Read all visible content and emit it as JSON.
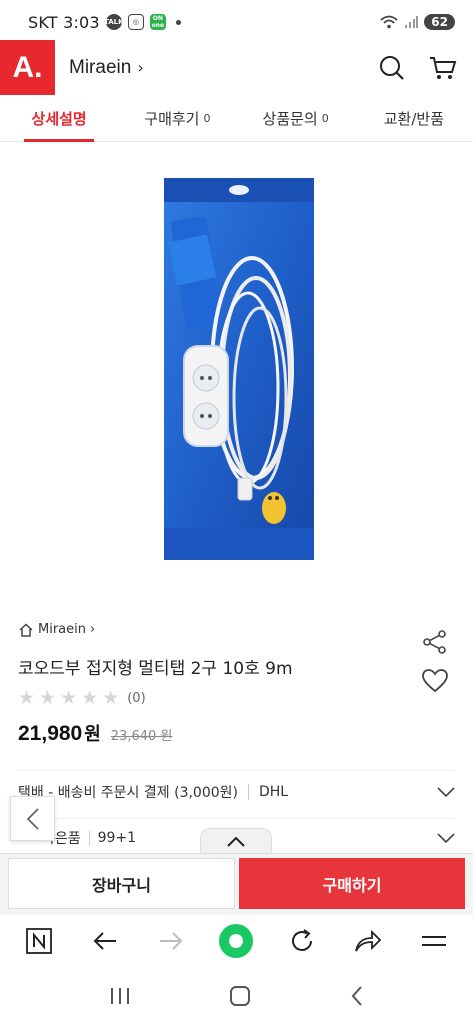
{
  "status_bar": {
    "carrier_time": "SKT 3:03",
    "battery": "62",
    "talk_icon_text": "TALK",
    "one_icon_text": "ON one"
  },
  "header": {
    "logo_text": "A.",
    "store_name": "Miraein",
    "store_chevron": "›"
  },
  "tabs": [
    {
      "label": "상세설명",
      "count": ""
    },
    {
      "label": "구매후기",
      "count": "0"
    },
    {
      "label": "상품문의",
      "count": "0"
    },
    {
      "label": "교환/반품",
      "count": ""
    }
  ],
  "product": {
    "seller": "Miraein",
    "seller_chevron": "›",
    "title": "코오드부 접지형 멀티탭 2구 10호 9m",
    "rating_stars": 0,
    "review_count": "(0)",
    "price": "21,980",
    "price_unit": "원",
    "original_price": "23,640 원"
  },
  "shipping": {
    "info": "택배 - 배송비 주문시 결제 (3,000원)",
    "carrier": "DHL"
  },
  "gift": {
    "label": "사은품",
    "value": "99+1"
  },
  "actions": {
    "cart_label": "장바구니",
    "buy_label": "구매하기"
  },
  "colors": {
    "brand_red": "#e8282f",
    "buy_red": "#e8353b",
    "package_blue": "#1f5fc9"
  }
}
